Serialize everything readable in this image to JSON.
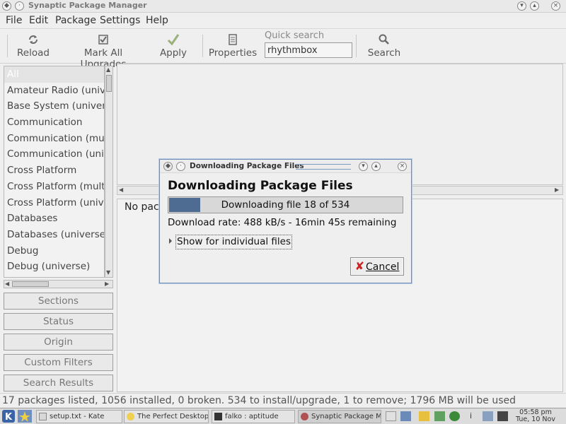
{
  "window": {
    "title": "Synaptic Package Manager"
  },
  "menu": [
    "File",
    "Edit",
    "Package",
    "Settings",
    "Help"
  ],
  "toolbar": {
    "reload": "Reload",
    "mark_all": "Mark All Upgrades",
    "apply": "Apply",
    "properties": "Properties",
    "quick_search_label": "Quick search",
    "quick_search_value": "rhythmbox",
    "search": "Search"
  },
  "sidebar": {
    "categories": [
      "All",
      "Amateur Radio (univ",
      "Base System (univer",
      "Communication",
      "Communication (mu",
      "Communication (uni",
      "Cross Platform",
      "Cross Platform (mult",
      "Cross Platform (univ",
      "Databases",
      "Databases (universe)",
      "Debug",
      "Debug (universe)"
    ],
    "selected": "All",
    "buttons": {
      "sections": "Sections",
      "status": "Status",
      "origin": "Origin",
      "custom_filters": "Custom Filters",
      "search_results": "Search Results"
    }
  },
  "details": {
    "text": "No pack"
  },
  "statusbar": {
    "text": "17 packages listed, 1056 installed, 0 broken. 534 to install/upgrade, 1 to remove; 1796 MB will be used"
  },
  "dialog": {
    "title": "Downloading Package Files",
    "heading": "Downloading Package Files",
    "progress_text": "Downloading file 18 of 534",
    "progress_fraction": 0.135,
    "rate": "Download rate: 488 kB/s - 16min 45s remaining",
    "expander": "Show for individual files",
    "cancel": "Cancel"
  },
  "taskbar": {
    "tasks": [
      "setup.txt - Kate",
      "The Perfect Desktop",
      "falko : aptitude",
      "Synaptic Package Ma"
    ],
    "clock_time": "05:58 pm",
    "clock_date": "Tue, 10 Nov"
  },
  "colors": {
    "progress_fill": "#4e6c92",
    "dialog_border": "#6f8fb8",
    "cancel_icon": "#cc2222"
  }
}
